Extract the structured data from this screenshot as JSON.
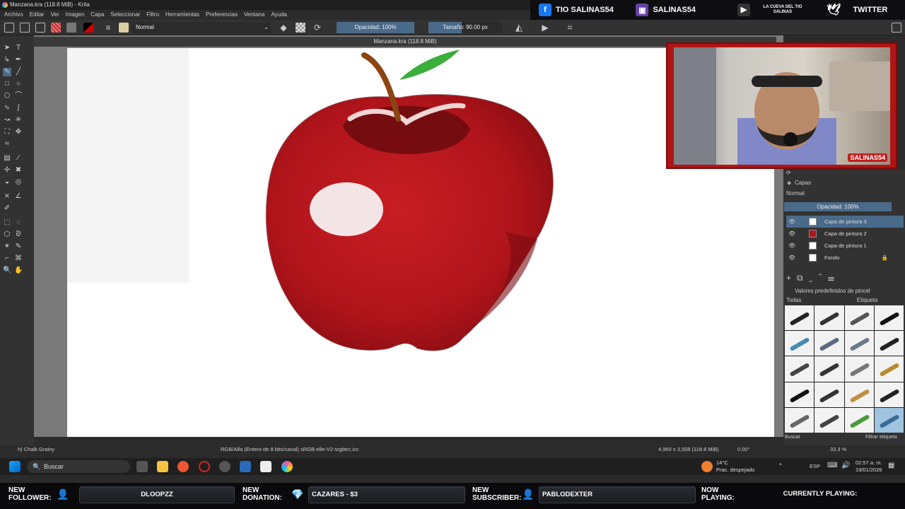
{
  "window": {
    "title": "Manzana.kra (118.8 MiB)  - Krita"
  },
  "menu": [
    "Archivo",
    "Editar",
    "Ver",
    "Imagen",
    "Capa",
    "Seleccionar",
    "Filtro",
    "Herramientas",
    "Preferencias",
    "Ventana",
    "Ayuda"
  ],
  "social": {
    "facebook": "TIO SALINAS54",
    "twitch": "SALINAS54",
    "youtube": "LA CUEVA DEL TIO SALINAS",
    "twitter": "TWITTER"
  },
  "toolbar": {
    "blend_mode": "Normal",
    "opacity": "Opacidad: 100%",
    "size": "Tamaño: 90.00 px"
  },
  "document": {
    "tab": "Manzana.kra (118.8 MiB)"
  },
  "webcam": {
    "watermark": "SALINAS54"
  },
  "layers": {
    "title": "Capas",
    "blend": "Normal",
    "opacity": "Opacidad: 100%",
    "items": [
      {
        "name": "Capa de pintura 3",
        "active": true
      },
      {
        "name": "Capa de pintura 2",
        "active": false
      },
      {
        "name": "Capa de pintura 1",
        "active": false
      },
      {
        "name": "Fondo",
        "active": false
      }
    ]
  },
  "brushes": {
    "title": "Valores predefinidos de pincel",
    "filter": "Todas",
    "tag": "Etiqueta",
    "search": "Buscar",
    "filter_tag": "Filtrar etiqueta"
  },
  "status": {
    "brush": "h) Chalk Grainy",
    "color": "RGB/Alfa (Entero de 8 bits/canal)  sRGB-elle-V2-srgbtrc.icc",
    "dims": "4,960 x 3,508 (118.8 MiB)",
    "rotation": "0.00°",
    "zoom": "33.3 %"
  },
  "taskbar": {
    "search": "Buscar",
    "weather_temp": "14°C",
    "weather_desc": "Prac. despejado",
    "lang": "ESP",
    "time": "02:57 a. m.",
    "date": "19/01/2026"
  },
  "stream": {
    "follower_label": "NEW FOLLOWER:",
    "follower": "DLOOPZZ",
    "donation_label": "NEW DONATION:",
    "donation": "CAZARES - $3",
    "subscriber_label": "NEW SUBSCRIBER:",
    "subscriber": "PABLODEXTER",
    "now_playing_label": "NOW PLAYING:",
    "now_playing": "CURRENTLY PLAYING:"
  },
  "colors": {
    "apple_red": "#b0141b",
    "panel": "#323232",
    "accent": "#4a6a8a",
    "webcam_frame": "#b01515"
  }
}
